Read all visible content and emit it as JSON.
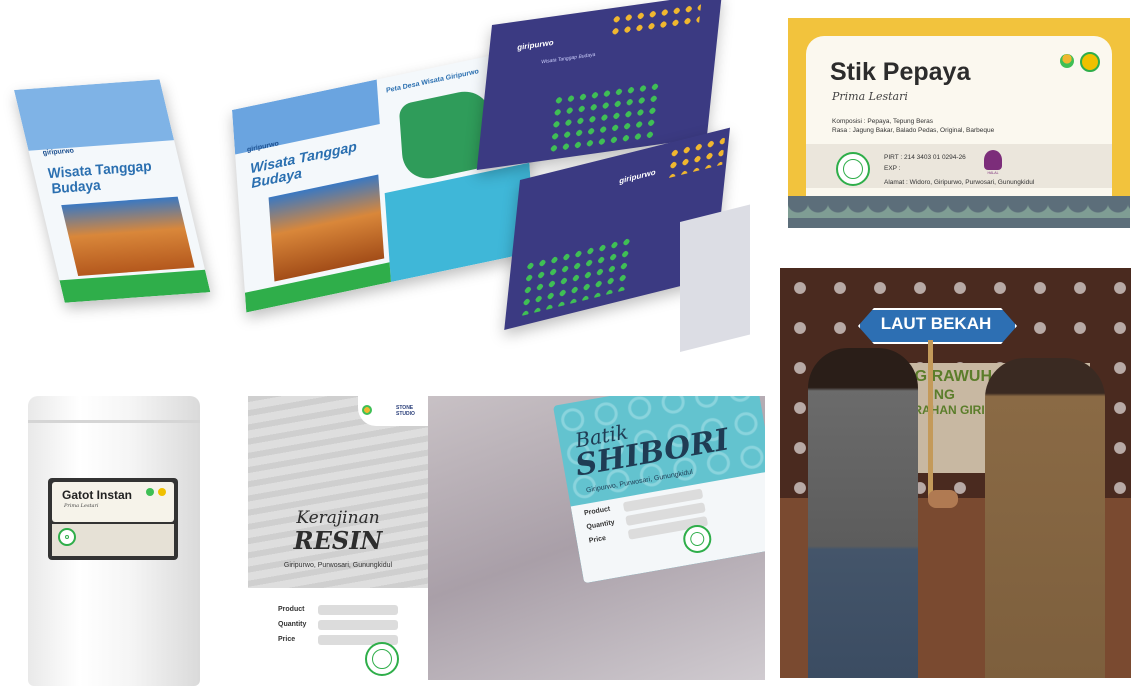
{
  "brochure": {
    "logo": "giripurwo",
    "title": "Wisata Tanggap Budaya",
    "map_title": "Peta Desa Wisata Giripurwo"
  },
  "folder": {
    "logo": "giripurwo",
    "subtitle": "Wisata Tanggap Budaya"
  },
  "stik_label": {
    "product_name": "Stik Pepaya",
    "brand": "Prima Lestari",
    "composition": "Komposisi : Pepaya, Tepung Beras",
    "flavors": "Rasa : Jagung Bakar, Balado Pedas, Original, Barbeque",
    "pirt": "PIRT : 214 3403 01 0294-26",
    "exp": "EXP :",
    "address": "Alamat : Widoro, Giripurwo, Purwosari, Gunungkidul",
    "halal_text": "HALAL"
  },
  "photo": {
    "sign_text": "LAUT BEKAH",
    "banner_line1": "GENG RAWUH",
    "banner_line2": "ING",
    "banner_line3": "KALURAHAN GIRIPURWO"
  },
  "pouch": {
    "product_name": "Gatot Instan",
    "brand": "Prima Lestari"
  },
  "resin": {
    "studio_name": "STONE STUDIO",
    "title_line1": "Kerajinan",
    "title_line2": "RESIN",
    "location": "Giripurwo, Purwosari, Gunungkidul",
    "field_product": "Product",
    "field_quantity": "Quantity",
    "field_price": "Price"
  },
  "shibori": {
    "title_line1": "Batik",
    "title_line2": "SHIBORI",
    "location": "Giripurwo, Purwosari, Gunungkidul",
    "field_product": "Product",
    "field_quantity": "Quantity",
    "field_price": "Price"
  },
  "colors": {
    "brand_blue": "#2a6fb0",
    "brand_green": "#2fae4a",
    "label_yellow": "#f2c33d",
    "folder_purple": "#3b3a82",
    "batik_teal": "#63c3cf"
  },
  "icons": [
    "leaf-logo-icon",
    "stamp-icon",
    "halal-icon",
    "map-icon",
    "hand-shake-icon"
  ]
}
